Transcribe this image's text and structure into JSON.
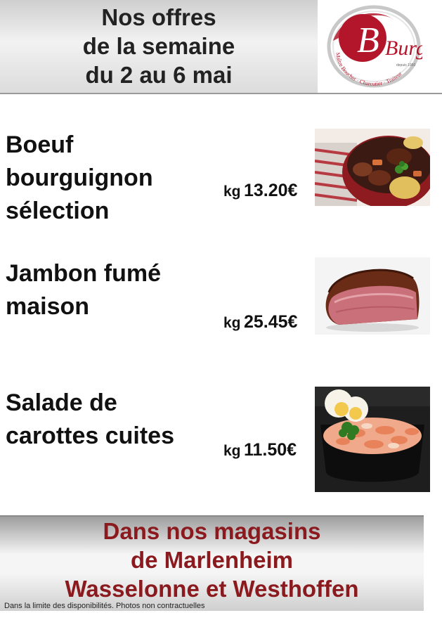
{
  "header": {
    "title_lines": [
      "Nos offres",
      "de la semaine",
      "du 2 au 6 mai"
    ],
    "logo": {
      "name": "Burg",
      "tagline": "Maître Boucher · Charcutier · Traiteur",
      "since": "depuis 1950",
      "colors": {
        "primary": "#b3162a",
        "ring": "#c8c8c8"
      }
    }
  },
  "products": [
    {
      "name_lines": [
        "Boeuf",
        "bourguignon",
        "sélection"
      ],
      "unit": "kg",
      "price": "13.20€",
      "photo_icon": "beef-stew-photo"
    },
    {
      "name_lines": [
        "Jambon fumé",
        "maison"
      ],
      "unit": "kg",
      "price": "25.45€",
      "photo_icon": "smoked-ham-photo"
    },
    {
      "name_lines": [
        "Salade de",
        "carottes cuites"
      ],
      "unit": "kg",
      "price": "11.50€",
      "photo_icon": "carrot-salad-photo"
    }
  ],
  "footer": {
    "lines": [
      "Dans nos magasins",
      "de Marlenheim",
      "Wasselonne et Westhoffen"
    ],
    "color": "#8b1a1f"
  },
  "disclaimer": "Dans la limite des disponibilités. Photos non contractuelles"
}
